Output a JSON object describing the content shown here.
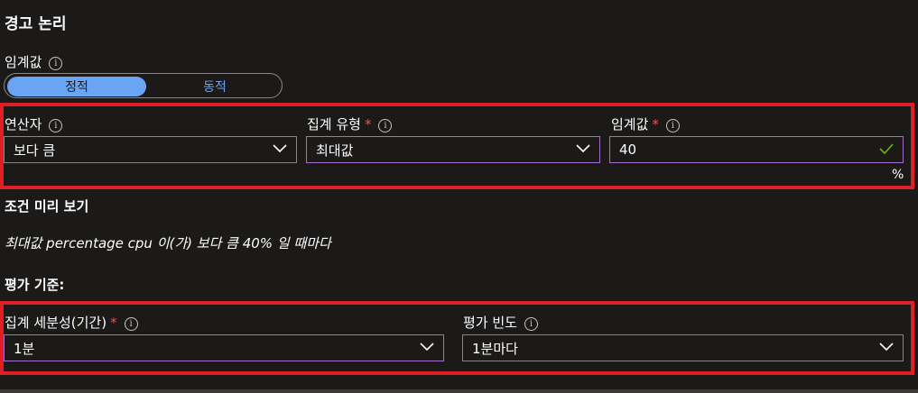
{
  "heading": "경고 논리",
  "threshold_type": {
    "label": "임계값",
    "options": [
      "정적",
      "동적"
    ],
    "selected": "정적"
  },
  "operator": {
    "label": "연산자",
    "value": "보다 큼"
  },
  "aggregation_type": {
    "label": "집계 유형",
    "required_mark": "*",
    "value": "최대값"
  },
  "threshold_value": {
    "label": "임계값",
    "required_mark": "*",
    "value": "40",
    "unit": "%"
  },
  "condition_preview": {
    "title": "조건 미리 보기",
    "text": "최대값 percentage cpu 이(가) 보다 큼 40% 일 때마다"
  },
  "evaluation": {
    "title": "평가 기준:",
    "granularity": {
      "label": "집계 세분성(기간)",
      "required_mark": "*",
      "value": "1분"
    },
    "frequency": {
      "label": "평가 빈도",
      "value": "1분마다"
    }
  },
  "colors": {
    "accent": "#6aa5f5",
    "highlight": "#e01e26",
    "required": "#e8544f",
    "valid": "#6bb700"
  }
}
